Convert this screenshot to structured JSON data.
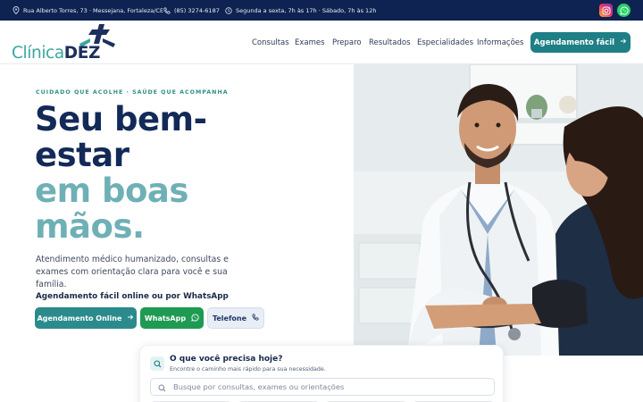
{
  "topbar": {
    "address": "Rua Alberto Torres, 73 · Messejana, Fortaleza/CE",
    "phone": "(85) 3274-6187",
    "hours": "Segunda a sexta, 7h às 17h · Sábado, 7h às 12h",
    "address_icon": "location-pin-icon",
    "phone_icon": "phone-icon",
    "hours_icon": "clock-icon",
    "social": [
      "instagram-icon",
      "whatsapp-icon"
    ]
  },
  "header": {
    "logo_prefix": "Clínica",
    "logo_suffix": "DEZ",
    "nav": [
      "Consultas",
      "Exames",
      "Preparo",
      "Resultados",
      "Especialidades",
      "Informações"
    ],
    "cta_label": "Agendamento fácil",
    "cta_icon": "arrow-right-icon"
  },
  "hero": {
    "eyebrow": "CUIDADO QUE ACOLHE · SAÚDE QUE ACOMPANHA",
    "title_line1": "Seu bem-",
    "title_line2": "estar",
    "title_line3": "em boas",
    "title_line4": "mãos.",
    "description": "Atendimento médico humanizado, consultas e exames com orientação clara para você e sua família.",
    "schedule_text": "Agendamento fácil online ou por WhatsApp",
    "buttons": [
      {
        "label": "Agendamento Online",
        "icon": "arrow-right-icon"
      },
      {
        "label": "WhatsApp",
        "icon": "whatsapp-icon"
      },
      {
        "label": "Telefone",
        "icon": "phone-icon"
      }
    ],
    "photo_icon": "doctor-patient-photo"
  },
  "search_card": {
    "title": "O que você precisa hoje?",
    "subtitle": "Encontre o caminho mais rápido para sua necessidade.",
    "placeholder": "Busque por consultas, exames ou orientações",
    "icon": "search-icon"
  },
  "colors": {
    "topbar": "#0f2352",
    "brand_dark": "#132a58",
    "brand_teal": "#6fb0b6",
    "cta": "#1f7f86",
    "whatsapp": "#1f9a52"
  }
}
